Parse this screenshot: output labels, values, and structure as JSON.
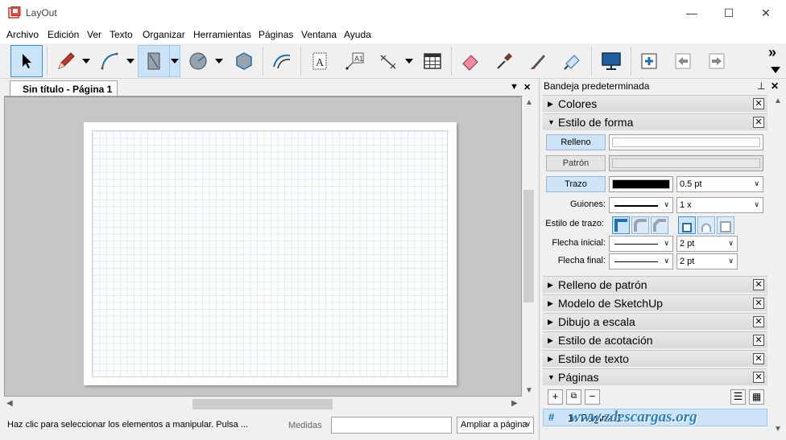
{
  "window": {
    "title": "LayOut",
    "minimize": "—",
    "maximize": "☐",
    "close": "✕"
  },
  "menu": [
    "Archivo",
    "Edición",
    "Ver",
    "Texto",
    "Organizar",
    "Herramientas",
    "Páginas",
    "Ventana",
    "Ayuda"
  ],
  "toolbar": {
    "overflow": "»"
  },
  "document": {
    "tab_label": "Sin título - Página 1",
    "tab_menu": "▼",
    "tab_close": "✕"
  },
  "status": {
    "hint": "Haz clic para seleccionar los elementos a manipular. Pulsa ...",
    "measure_label": "Medidas",
    "measure_value": "",
    "zoom": "Ampliar a página"
  },
  "tray": {
    "title": "Bandeja predeterminada",
    "pin": "⊥",
    "close": "✕",
    "panels": {
      "colores": "Colores",
      "estilo_forma": "Estilo de forma",
      "relleno_patron": "Relleno de patrón",
      "modelo_sketchup": "Modelo de SketchUp",
      "dibujo_escala": "Dibujo a escala",
      "estilo_acotacion": "Estilo de acotación",
      "estilo_texto": "Estilo de texto",
      "paginas": "Páginas"
    },
    "shape_style": {
      "relleno": "Relleno",
      "patron": "Patrón",
      "trazo": "Trazo",
      "trazo_color": "#000000",
      "trazo_width": "0.5 pt",
      "guiones_label": "Guiones:",
      "guiones_scale": "1 x",
      "estilo_trazo_label": "Estilo de trazo:",
      "flecha_inicial_label": "Flecha inicial:",
      "flecha_inicial_size": "2 pt",
      "flecha_final_label": "Flecha final:",
      "flecha_final_size": "2 pt"
    },
    "pages": {
      "row_index": "1:",
      "row_name": "Página 1",
      "hash": "#"
    }
  },
  "watermark": "www.zdescargas.org"
}
